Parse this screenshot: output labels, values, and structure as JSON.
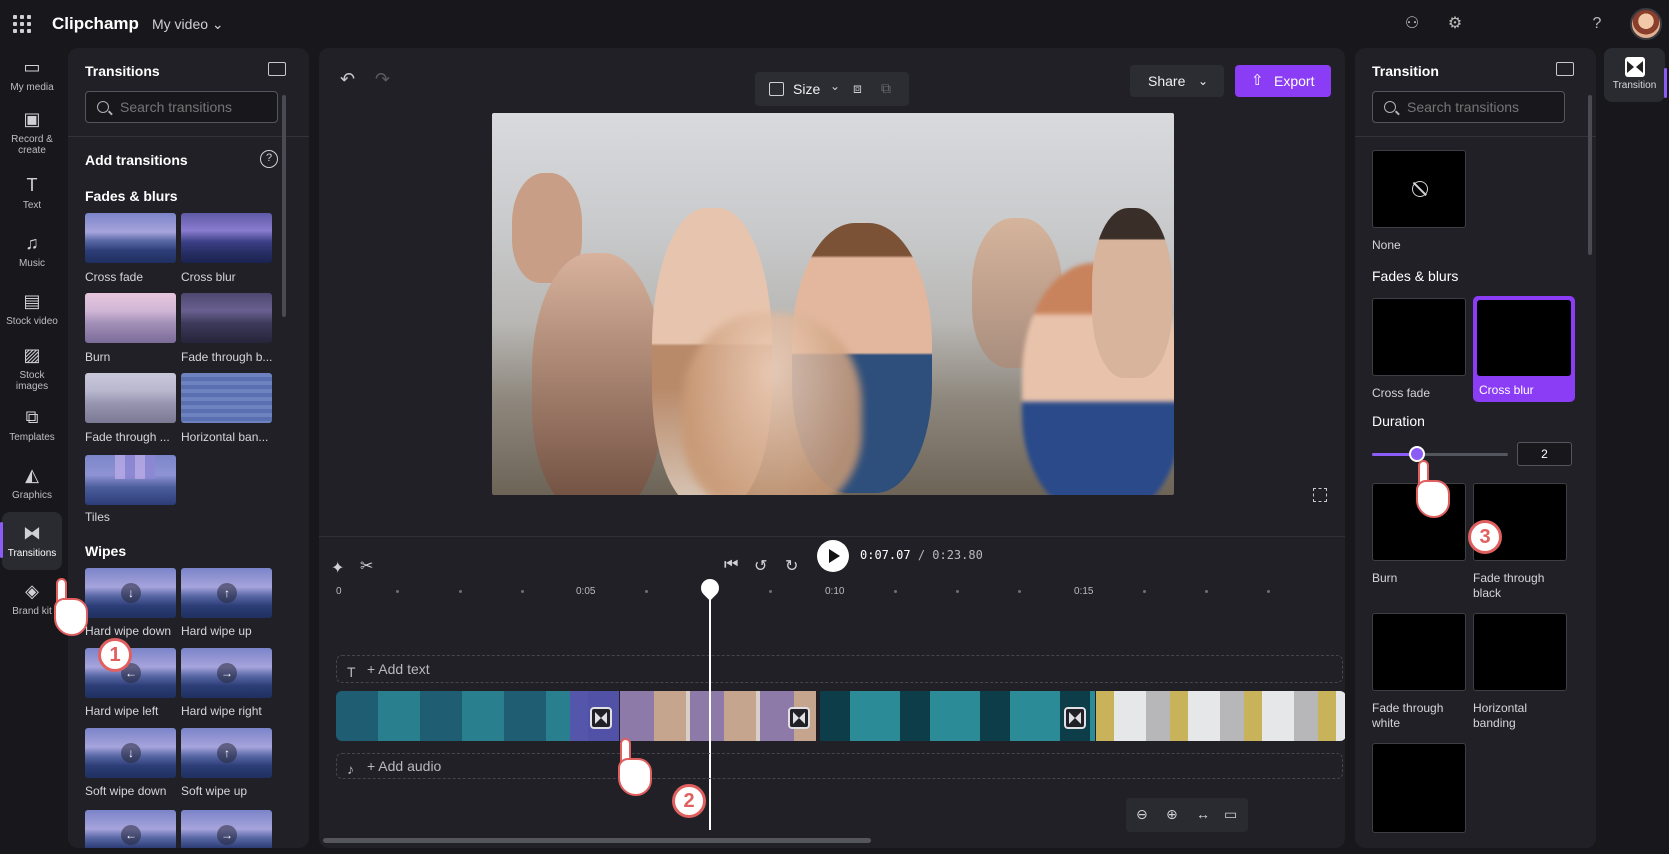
{
  "app": {
    "title": "Clipchamp",
    "project_name": "My video"
  },
  "rail": [
    {
      "label": "My media"
    },
    {
      "label": "Record & create"
    },
    {
      "label": "Text"
    },
    {
      "label": "Music"
    },
    {
      "label": "Stock video"
    },
    {
      "label": "Stock images"
    },
    {
      "label": "Templates"
    },
    {
      "label": "Graphics"
    },
    {
      "label": "Transitions"
    },
    {
      "label": "Brand kit"
    }
  ],
  "left_panel": {
    "title": "Transitions",
    "search_placeholder": "Search transitions",
    "add_title": "Add transitions",
    "sections": {
      "fades": "Fades & blurs",
      "wipes": "Wipes"
    },
    "fades_items": [
      "Cross fade",
      "Cross blur",
      "Burn",
      "Fade through b...",
      "Fade through ...",
      "Horizontal ban...",
      "Tiles"
    ],
    "wipes_items": [
      "Hard wipe down",
      "Hard wipe up",
      "Hard wipe left",
      "Hard wipe right",
      "Soft wipe down",
      "Soft wipe up"
    ]
  },
  "toolbar": {
    "size_label": "Size",
    "share_label": "Share",
    "export_label": "Export"
  },
  "timeline": {
    "current_time": "0:07.07",
    "total_time": "/ 0:23.80",
    "ruler": [
      "0",
      "0:05",
      "0:10",
      "0:15"
    ],
    "add_text": "+ Add text",
    "add_audio": "+ Add audio"
  },
  "right_panel": {
    "title": "Transition",
    "search_placeholder": "Search transitions",
    "none_label": "None",
    "fades_title": "Fades & blurs",
    "cross_fade": "Cross fade",
    "cross_blur": "Cross blur",
    "duration_title": "Duration",
    "duration_value": "2",
    "duration_fraction": 0.33,
    "burn": "Burn",
    "fade_black": "Fade through black",
    "fade_white": "Fade through white",
    "horizontal_banding": "Horizontal banding"
  },
  "far_rail": {
    "label": "Transition"
  },
  "callouts": [
    "1",
    "2",
    "3"
  ],
  "colors": {
    "accent": "#8b3df5",
    "background": "#18181c",
    "panel": "#202026",
    "callout": "#e05f5f"
  }
}
